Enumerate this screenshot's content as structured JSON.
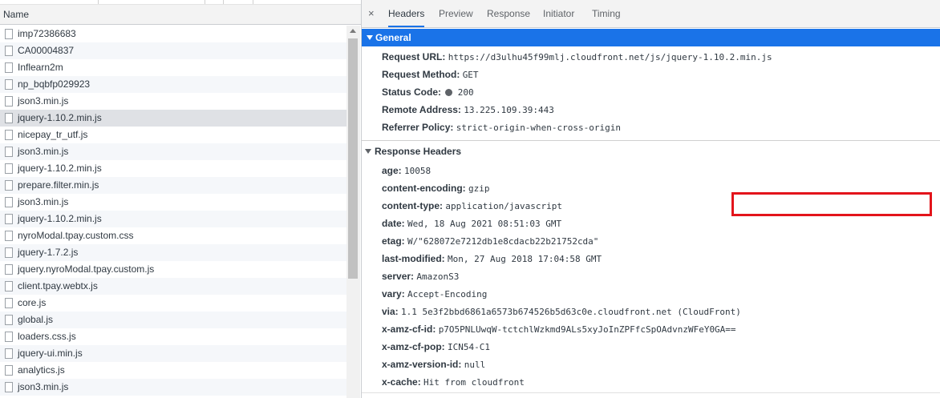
{
  "list": {
    "header": "Name",
    "items": [
      "imp72386683",
      "CA00004837",
      "Inflearn2m",
      "np_bqbfp029923",
      "json3.min.js",
      "jquery-1.10.2.min.js",
      "nicepay_tr_utf.js",
      "json3.min.js",
      "jquery-1.10.2.min.js",
      "prepare.filter.min.js",
      "json3.min.js",
      "jquery-1.10.2.min.js",
      "nyroModal.tpay.custom.css",
      "jquery-1.7.2.js",
      "jquery.nyroModal.tpay.custom.js",
      "client.tpay.webtx.js",
      "core.js",
      "global.js",
      "loaders.css.js",
      "jquery-ui.min.js",
      "analytics.js",
      "json3.min.js"
    ],
    "selected_index": 5
  },
  "tabs": {
    "close": "×",
    "headers": "Headers",
    "preview": "Preview",
    "response": "Response",
    "initiator": "Initiator",
    "timing": "Timing"
  },
  "general": {
    "title": "General",
    "request_url_key": "Request URL:",
    "request_url_val": "https://d3ulhu45f99mlj.cloudfront.net/js/jquery-1.10.2.min.js",
    "request_method_key": "Request Method:",
    "request_method_val": "GET",
    "status_code_key": "Status Code:",
    "status_code_val": "200",
    "remote_address_key": "Remote Address:",
    "remote_address_val": "13.225.109.39:443",
    "referrer_policy_key": "Referrer Policy:",
    "referrer_policy_val": "strict-origin-when-cross-origin"
  },
  "response_headers": {
    "title": "Response Headers",
    "rows": [
      {
        "k": "age:",
        "v": "10058"
      },
      {
        "k": "content-encoding:",
        "v": "gzip"
      },
      {
        "k": "content-type:",
        "v": "application/javascript"
      },
      {
        "k": "date:",
        "v": "Wed, 18 Aug 2021 08:51:03 GMT"
      },
      {
        "k": "etag:",
        "v": "W/\"628072e7212db1e8cdacb22b21752cda\""
      },
      {
        "k": "last-modified:",
        "v": "Mon, 27 Aug 2018 17:04:58 GMT"
      },
      {
        "k": "server:",
        "v": "AmazonS3"
      },
      {
        "k": "vary:",
        "v": "Accept-Encoding"
      },
      {
        "k": "via:",
        "v": "1.1 5e3f2bbd6861a6573b674526b5d63c0e.cloudfront.net (CloudFront)"
      },
      {
        "k": "x-amz-cf-id:",
        "v": "p7O5PNLUwqW-tctchlWzkmd9ALs5xyJoInZPFfcSpOAdvnzWFeY0GA=="
      },
      {
        "k": "x-amz-cf-pop:",
        "v": "ICN54-C1"
      },
      {
        "k": "x-amz-version-id:",
        "v": "null"
      },
      {
        "k": "x-cache:",
        "v": "Hit from cloudfront"
      }
    ]
  },
  "colors": {
    "accent": "#1a73e8",
    "highlight_box": "#e3141b",
    "status_dot": "#5f6368"
  }
}
